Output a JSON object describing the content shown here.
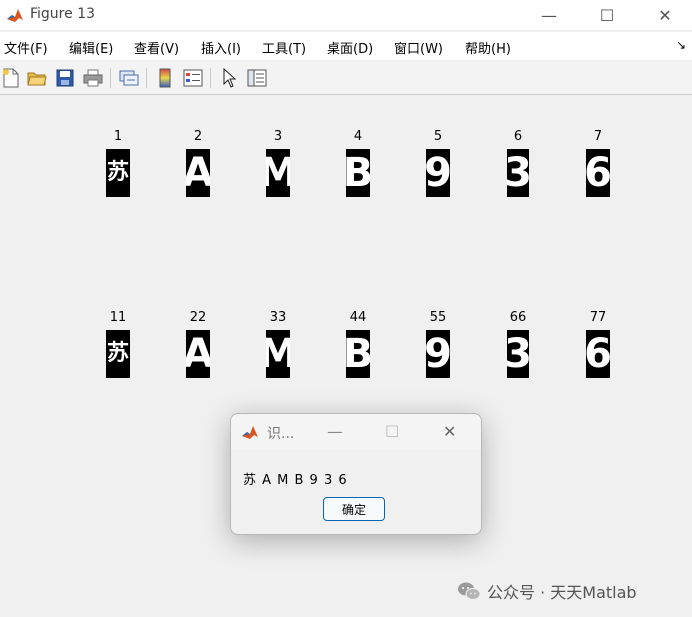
{
  "window": {
    "title": "Figure 13",
    "minimize_glyph": "—",
    "maximize_glyph": "☐",
    "close_glyph": "✕",
    "icon": "matlab-logo-icon"
  },
  "menu": {
    "items": [
      "文件(F)",
      "编辑(E)",
      "查看(V)",
      "插入(I)",
      "工具(T)",
      "桌面(D)",
      "窗口(W)",
      "帮助(H)"
    ],
    "dock_glyph": "↘"
  },
  "toolbar": {
    "icons": [
      "new-figure-icon",
      "open-file-icon",
      "save-icon",
      "print-icon",
      "link-plot-icon",
      "insert-colorbar-icon",
      "insert-legend-icon",
      "edit-plot-arrow-icon",
      "property-inspector-icon"
    ]
  },
  "figure": {
    "row1": [
      {
        "label": "1",
        "char": "苏"
      },
      {
        "label": "2",
        "char": "A"
      },
      {
        "label": "3",
        "char": "M"
      },
      {
        "label": "4",
        "char": "B"
      },
      {
        "label": "5",
        "char": "9"
      },
      {
        "label": "6",
        "char": "3"
      },
      {
        "label": "7",
        "char": "6"
      }
    ],
    "row2": [
      {
        "label": "11",
        "char": "苏"
      },
      {
        "label": "22",
        "char": "A"
      },
      {
        "label": "33",
        "char": "M"
      },
      {
        "label": "44",
        "char": "B"
      },
      {
        "label": "55",
        "char": "9"
      },
      {
        "label": "66",
        "char": "3"
      },
      {
        "label": "77",
        "char": "6"
      }
    ]
  },
  "dialog": {
    "title": "识...",
    "message": "苏 A M B 9 3 6",
    "ok_label": "确定",
    "minimize_glyph": "—",
    "maximize_glyph": "☐",
    "close_glyph": "✕"
  },
  "watermark": {
    "text": "公众号 · 天天Matlab",
    "icon": "wechat-icon"
  },
  "colors": {
    "background": "#f0f0f0",
    "accent": "#0a64b4"
  }
}
